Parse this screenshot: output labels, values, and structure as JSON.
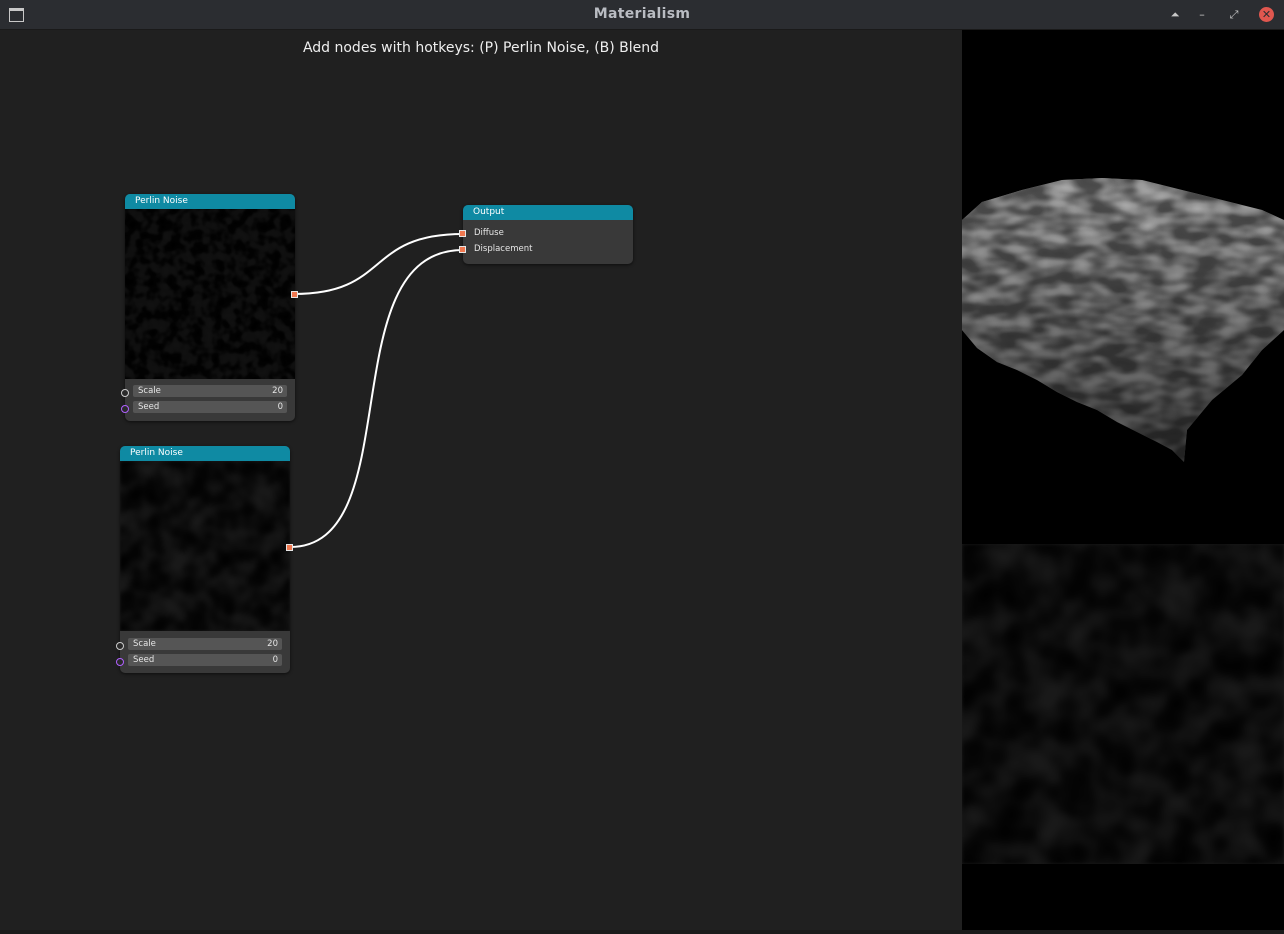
{
  "window": {
    "title": "Materialism",
    "buttons": {
      "shade": "⏶",
      "minimize": "–",
      "maximize": "⤢",
      "close": "✕"
    }
  },
  "canvas": {
    "hint": "Add nodes with hotkeys: (P) Perlin Noise, (B) Blend"
  },
  "nodes": [
    {
      "title": "Perlin Noise",
      "params": [
        {
          "label": "Scale",
          "value": "20"
        },
        {
          "label": "Seed",
          "value": "0"
        }
      ]
    },
    {
      "title": "Perlin Noise",
      "params": [
        {
          "label": "Scale",
          "value": "20"
        },
        {
          "label": "Seed",
          "value": "0"
        }
      ]
    }
  ],
  "output_node": {
    "title": "Output",
    "inputs": [
      "Diffuse",
      "Displacement"
    ]
  },
  "colors": {
    "node_header": "#0f8aa3",
    "canvas_bg": "#202020",
    "socket_output": "#f07850",
    "socket_seed": "#b060ff",
    "close_button": "#e0574f"
  }
}
